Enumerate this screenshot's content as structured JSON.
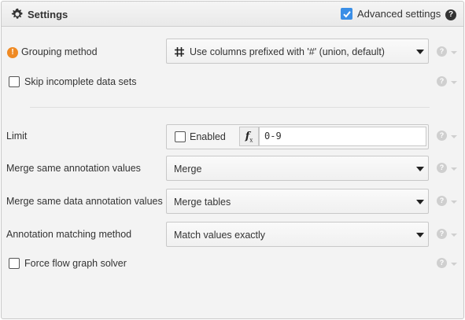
{
  "header": {
    "title": "Settings",
    "advanced_label": "Advanced settings",
    "advanced_checked": true,
    "help_glyph": "?"
  },
  "grouping": {
    "label": "Grouping method",
    "value": "Use columns prefixed with '#' (union, default)",
    "info_glyph": "!"
  },
  "skip_incomplete": {
    "label": "Skip incomplete data sets",
    "checked": false
  },
  "limit": {
    "label": "Limit",
    "enabled_label": "Enabled",
    "enabled": false,
    "fx_glyph": "f",
    "fx_sub": "x",
    "value": "0-9"
  },
  "merge_annotation": {
    "label": "Merge same annotation values",
    "value": "Merge"
  },
  "merge_data_annotation": {
    "label": "Merge same data annotation values",
    "value": "Merge tables"
  },
  "annotation_matching": {
    "label": "Annotation matching method",
    "value": "Match values exactly"
  },
  "force_flow": {
    "label": "Force flow graph solver",
    "checked": false
  },
  "help": {
    "glyph": "?"
  },
  "colors": {
    "accent": "#3a8ee6",
    "info": "#ef8a24",
    "panel_bg": "#f3f3f3"
  }
}
